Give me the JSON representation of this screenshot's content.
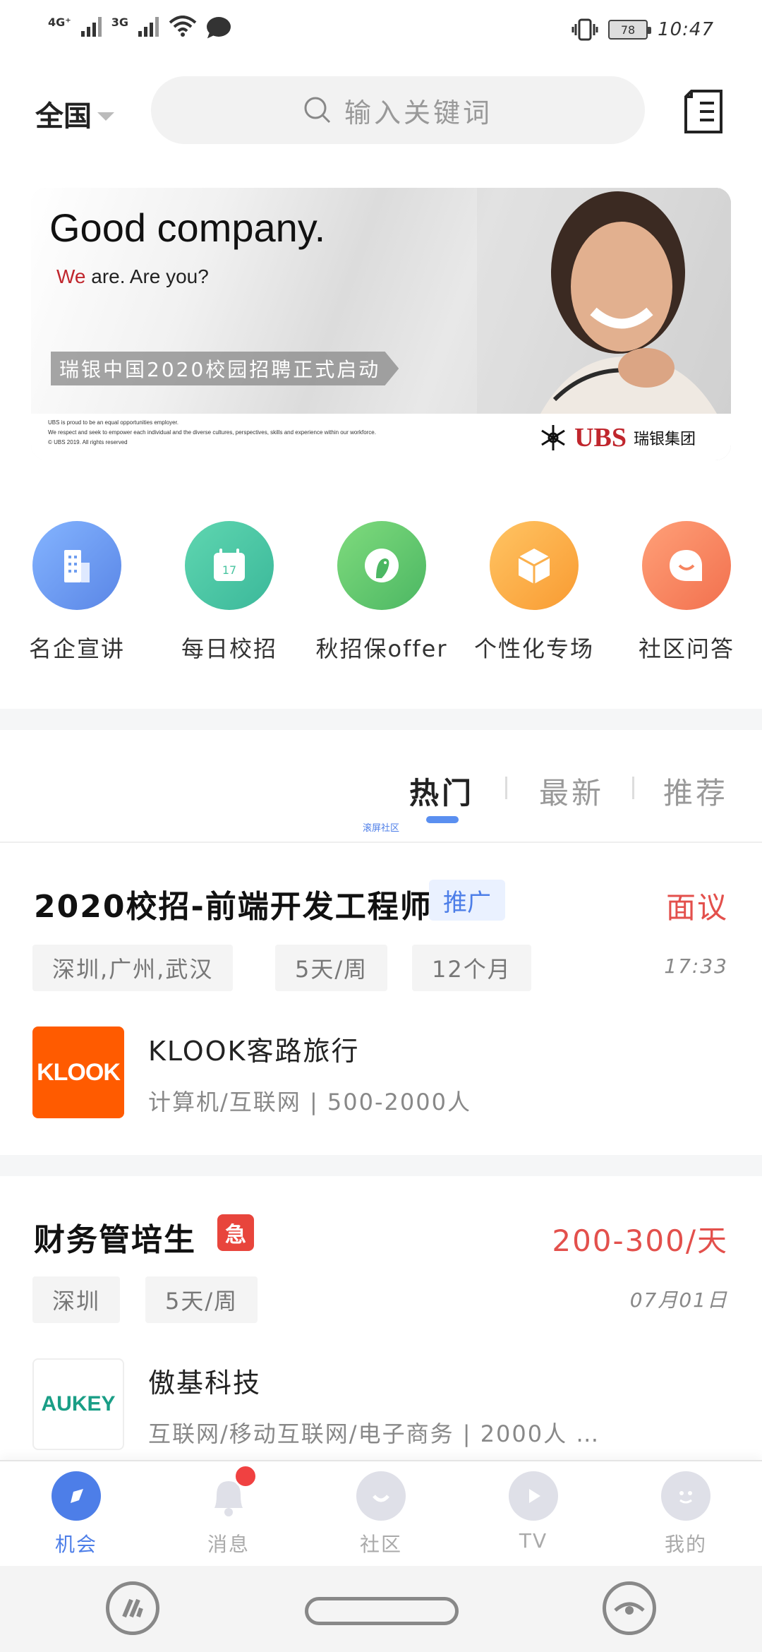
{
  "status_bar": {
    "network_1": "4G⁺",
    "network_2": "3G",
    "battery": "78",
    "time": "10:47"
  },
  "topbar": {
    "region": "全国",
    "search_placeholder": "输入关键词",
    "icons": [
      "search-icon",
      "resume-book-icon",
      "chevron-down-icon"
    ]
  },
  "banner": {
    "title": "Good company.",
    "subtitle_we": "We",
    "subtitle_rest": " are. Are you?",
    "ribbon": "瑞银中国2020校园招聘正式启动",
    "fine_1": "UBS is proud to be an equal opportunities employer.",
    "fine_2": "We respect and seek to empower each individual and the diverse cultures, perspectives, skills and experience within our workforce.",
    "fine_3": "© UBS 2019. All rights reserved",
    "brand": "UBS",
    "brand_cn": "瑞银集团",
    "colors": {
      "brand_red": "#c0262d"
    }
  },
  "quick_links": [
    {
      "label": "名企宣讲",
      "icon": "building-icon",
      "color": "#6f9ef0"
    },
    {
      "label": "每日校招",
      "icon": "calendar-icon",
      "color": "#49c4a0"
    },
    {
      "label": "秋招保offer",
      "icon": "bird-icon",
      "color": "#62c572"
    },
    {
      "label": "个性化专场",
      "icon": "box-icon",
      "color": "#fcab45"
    },
    {
      "label": "社区问答",
      "icon": "chat-smile-icon",
      "color": "#f6845f"
    }
  ],
  "feed_tabs": {
    "tabs": [
      "热门",
      "最新",
      "推荐"
    ],
    "active": "热门",
    "tiny_link": "滚屏社区"
  },
  "jobs": [
    {
      "title": "2020校招-前端开发工程师",
      "badge": "推广",
      "salary": "面议",
      "tags": [
        "深圳,广州,武汉",
        "5天/周",
        "12个月"
      ],
      "time": "17:33",
      "company": "KLOOK客路旅行",
      "company_meta": "计算机/互联网 | 500-2000人",
      "logo_text": "KLOOK",
      "logo_color": "#ff5b00"
    },
    {
      "title": "财务管培生",
      "badge": "急",
      "salary": "200-300/天",
      "tags": [
        "深圳",
        "5天/周"
      ],
      "time": "07月01日",
      "company": "傲基科技",
      "company_meta": "互联网/移动互联网/电子商务 | 2000人 …",
      "logo_text": "AUKEY",
      "logo_color": "#1a9e86"
    }
  ],
  "bottom_nav": [
    {
      "label": "机会",
      "icon": "compass-icon",
      "active": true
    },
    {
      "label": "消息",
      "icon": "bell-icon",
      "active": false,
      "has_dot": true
    },
    {
      "label": "社区",
      "icon": "smile-icon",
      "active": false
    },
    {
      "label": "TV",
      "icon": "play-icon",
      "active": false
    },
    {
      "label": "我的",
      "icon": "profile-icon",
      "active": false
    }
  ],
  "colors": {
    "accent": "#4d7ee8",
    "salary": "#e3504c"
  }
}
